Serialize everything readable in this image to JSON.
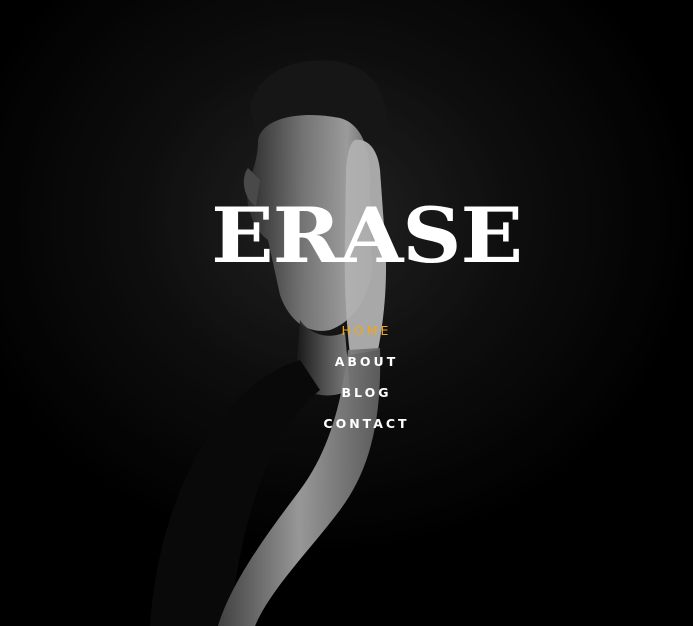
{
  "site": {
    "logo": "ERASE"
  },
  "nav": {
    "items": [
      {
        "label": "HOME",
        "active": true
      },
      {
        "label": "ABOUT",
        "active": false
      },
      {
        "label": "BLOG",
        "active": false
      },
      {
        "label": "CONTACT",
        "active": false
      }
    ]
  },
  "colors": {
    "background": "#000000",
    "text": "#ffffff",
    "accent": "#f0a818"
  }
}
